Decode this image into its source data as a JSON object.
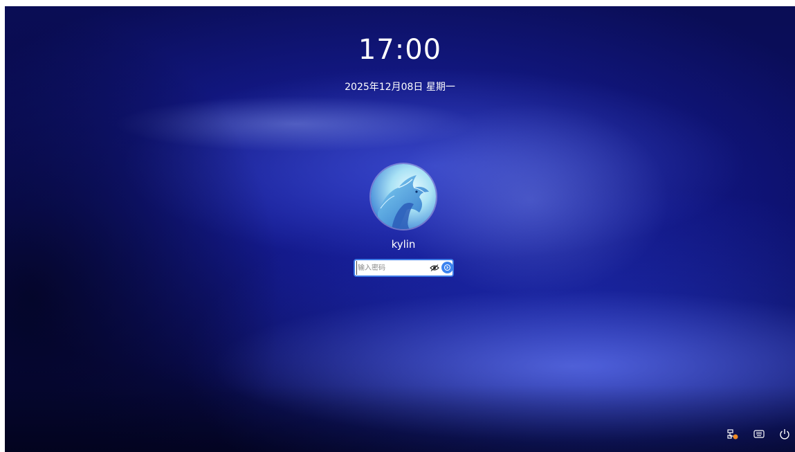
{
  "lockscreen": {
    "time": "17:00",
    "date": "2025年12月08日 星期一",
    "username": "kylin",
    "password_placeholder": "输入密码"
  },
  "icons": {
    "avatar": "dragon-avatar",
    "show_password": "eye-icon",
    "submit": "unlock-arrow-icon",
    "network": "network-offline-icon",
    "keyboard": "keyboard-icon",
    "power": "power-icon"
  },
  "colors": {
    "accent": "#3d84ef",
    "input_border": "#3d7be8",
    "network_warning": "#f08a24"
  }
}
